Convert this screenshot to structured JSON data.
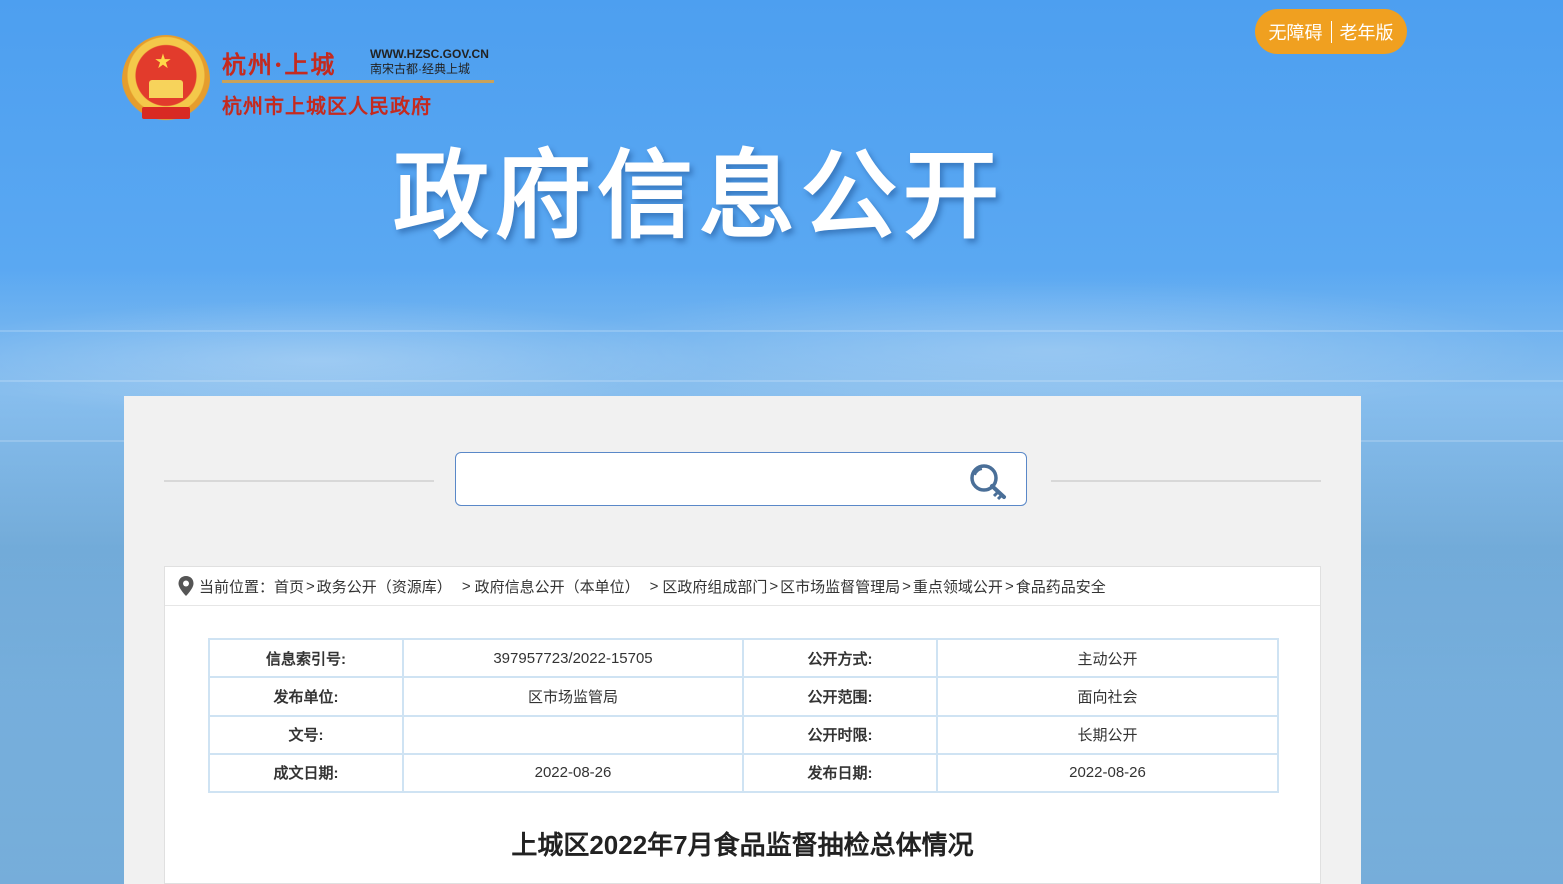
{
  "header": {
    "logo_cn": "杭州·上城",
    "logo_url": "WWW.HZSC.GOV.CN",
    "logo_slogan": "南宋古都·经典上城",
    "logo_full": "杭州市上城区人民政府",
    "accessibility_label": "无障碍",
    "elderly_label": "老年版",
    "hero_title": "政府信息公开"
  },
  "search": {
    "placeholder": "",
    "value": ""
  },
  "breadcrumb": {
    "prefix": "当前位置：",
    "items": [
      "首页",
      "政务公开（资源库）",
      "政府信息公开（本单位）",
      "区政府组成部门",
      "区市场监督管理局",
      "重点领域公开",
      "食品药品安全"
    ],
    "separator": ">"
  },
  "meta": {
    "rows": [
      {
        "l1": "信息索引号:",
        "v1": "397957723/2022-15705",
        "l2": "公开方式:",
        "v2": "主动公开"
      },
      {
        "l1": "发布单位:",
        "v1": "区市场监管局",
        "l2": "公开范围:",
        "v2": "面向社会"
      },
      {
        "l1": "文号:",
        "v1": "",
        "l2": "公开时限:",
        "v2": "长期公开"
      },
      {
        "l1": "成文日期:",
        "v1": "2022-08-26",
        "l2": "发布日期:",
        "v2": "2022-08-26"
      }
    ]
  },
  "document": {
    "title": "上城区2022年7月食品监督抽检总体情况"
  },
  "colors": {
    "accent_orange": "#f0a020",
    "brand_red": "#c42a1f",
    "table_border": "#cfe3f3",
    "search_border": "#5a88c8"
  }
}
